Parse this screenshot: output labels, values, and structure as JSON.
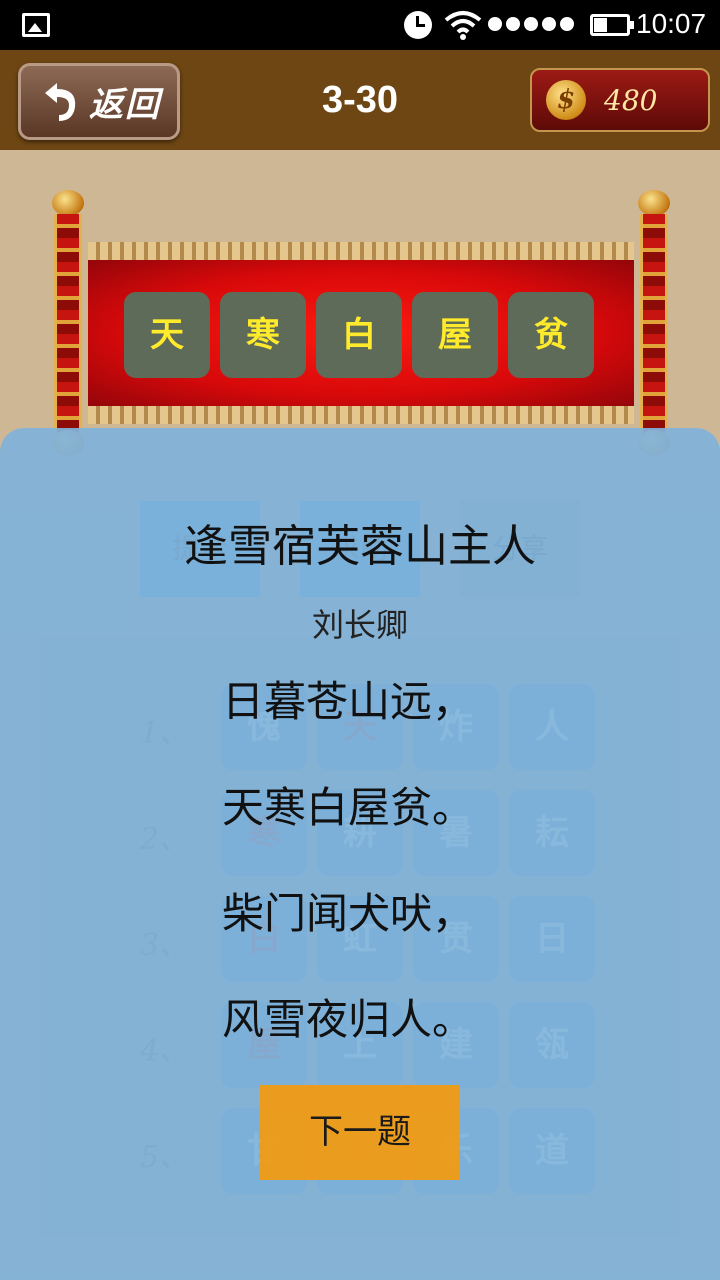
{
  "status_bar": {
    "time": "10:07"
  },
  "header": {
    "back_label": "返回",
    "level": "3-30",
    "coins": "480"
  },
  "answer": [
    "天",
    "寒",
    "白",
    "屋",
    "贫"
  ],
  "board": {
    "buttons": [
      "提示",
      "求助",
      "分享"
    ],
    "row_numbers": [
      "1、",
      "2、",
      "3、",
      "4、",
      "5、"
    ],
    "rows": [
      [
        "愧",
        "天",
        "炸",
        "人"
      ],
      [
        "寒",
        "耕",
        "暑",
        "耘"
      ],
      [
        "白",
        "虹",
        "贯",
        "日"
      ],
      [
        "屋",
        "上",
        "建",
        "瓴"
      ],
      [
        "甘",
        "贫",
        "乐",
        "道"
      ]
    ]
  },
  "poem": {
    "title": "逢雪宿芙蓉山主人",
    "author": "刘长卿",
    "lines": [
      "日暮苍山远，",
      "天寒白屋贫。",
      "柴门闻犬吠，",
      "风雪夜归人。"
    ]
  },
  "next_label": "下一题",
  "colors": {
    "header_bg": "#6e4613",
    "overlay": "#80b3da",
    "next_button": "#f09b14",
    "answer_text": "#ffea2c"
  }
}
